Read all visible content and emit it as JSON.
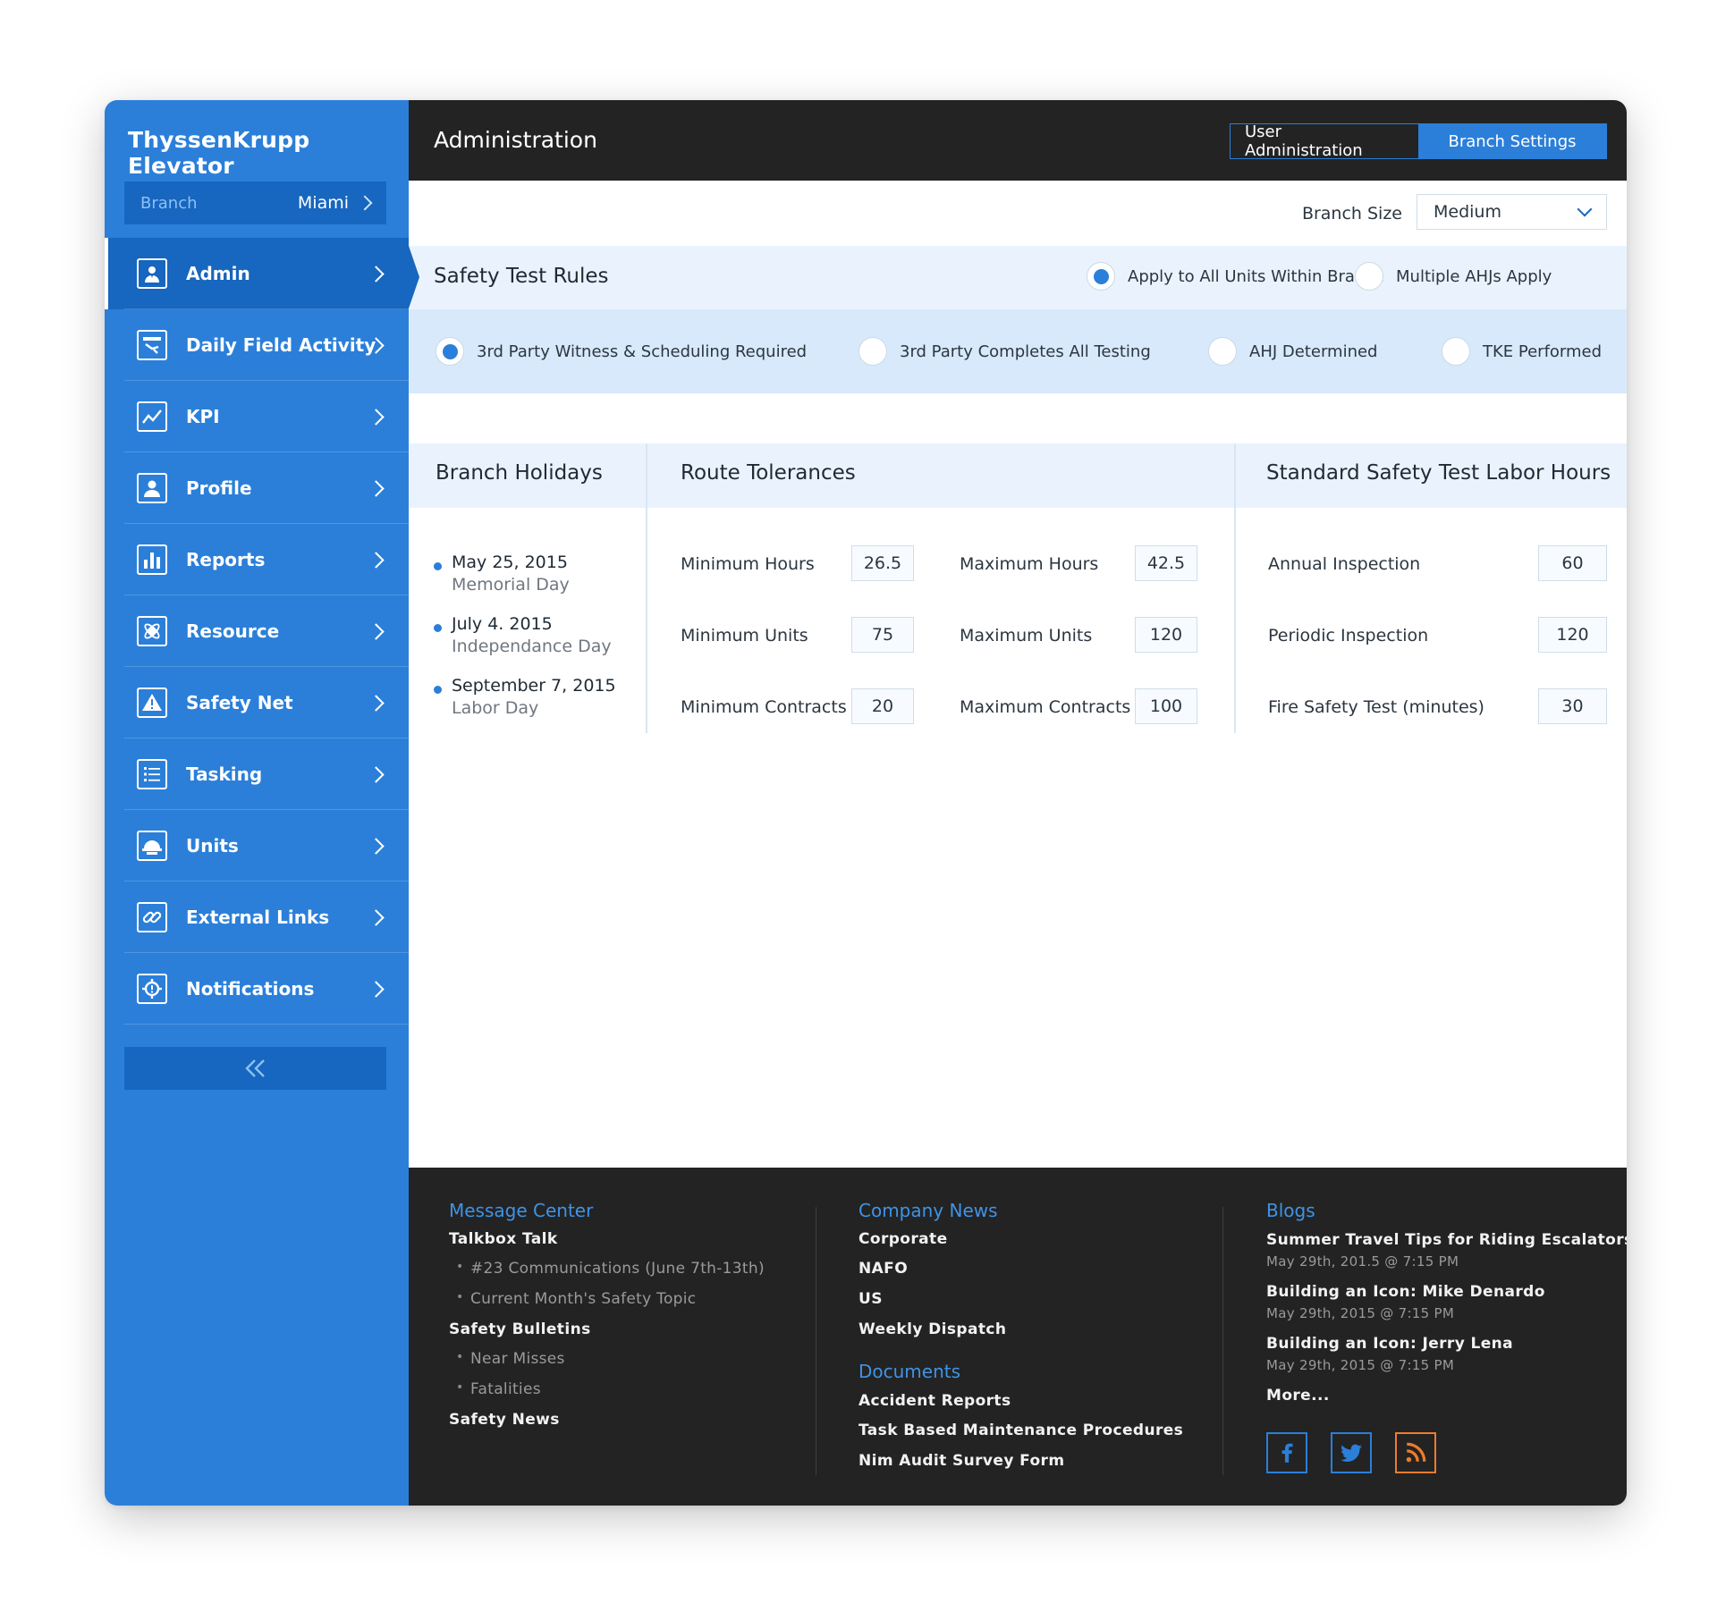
{
  "app": {
    "brand": "ThyssenKrupp Elevator",
    "branch_label": "Branch",
    "branch_value": "Miami"
  },
  "sidebar": {
    "items": [
      {
        "label": "Admin",
        "icon": "admin-icon",
        "active": true
      },
      {
        "label": "Daily Field Activity",
        "icon": "daily-field-activity-icon"
      },
      {
        "label": "KPI",
        "icon": "kpi-chart-icon"
      },
      {
        "label": "Profile",
        "icon": "profile-icon"
      },
      {
        "label": "Reports",
        "icon": "reports-bar-chart-icon"
      },
      {
        "label": "Resource",
        "icon": "resource-icon"
      },
      {
        "label": "Safety Net",
        "icon": "warning-icon"
      },
      {
        "label": "Tasking",
        "icon": "list-icon"
      },
      {
        "label": "Units",
        "icon": "hard-hat-icon"
      },
      {
        "label": "External Links",
        "icon": "link-icon"
      },
      {
        "label": "Notifications",
        "icon": "notification-gear-icon"
      }
    ],
    "collapse_icon": "double-chevron-left-icon"
  },
  "header": {
    "title": "Administration",
    "tabs": [
      "User Administration",
      "Branch Settings"
    ],
    "active_tab": "Branch Settings"
  },
  "branch_size": {
    "label": "Branch Size",
    "value": "Medium"
  },
  "safety_test_rules": {
    "title": "Safety Test Rules",
    "scope_options": [
      {
        "label": "Apply to All Units Within Branch",
        "selected": true
      },
      {
        "label": "Multiple AHJs Apply",
        "selected": false
      }
    ],
    "options": [
      {
        "label": "3rd Party Witness & Scheduling Required",
        "selected": true
      },
      {
        "label": "3rd Party Completes All Testing",
        "selected": false
      },
      {
        "label": "AHJ Determined",
        "selected": false
      },
      {
        "label": "TKE  Performed",
        "selected": false
      }
    ]
  },
  "branch_holidays": {
    "title": "Branch Holidays",
    "items": [
      {
        "date": "May 25, 2015",
        "name": "Memorial Day"
      },
      {
        "date": "July 4. 2015",
        "name": "Independance Day"
      },
      {
        "date": "September 7, 2015",
        "name": "Labor Day"
      }
    ]
  },
  "route_tolerances": {
    "title": "Route Tolerances",
    "fields": [
      {
        "label": "Minimum Hours",
        "value": "26.5"
      },
      {
        "label": "Maximum Hours",
        "value": "42.5"
      },
      {
        "label": "Minimum Units",
        "value": "75"
      },
      {
        "label": "Maximum Units",
        "value": "120"
      },
      {
        "label": "Minimum Contracts",
        "value": "20"
      },
      {
        "label": "Maximum Contracts",
        "value": "100"
      }
    ]
  },
  "labor_hours": {
    "title": "Standard Safety Test Labor Hours",
    "fields": [
      {
        "label": "Annual Inspection",
        "value": "60"
      },
      {
        "label": "Periodic Inspection",
        "value": "120"
      },
      {
        "label": "Fire Safety Test (minutes)",
        "value": "30"
      }
    ]
  },
  "footer": {
    "message_center": {
      "title": "Message Center",
      "talkbox": "Talkbox Talk",
      "talkbox_items": [
        "#23 Communications (June 7th-13th)",
        "Current Month's Safety Topic"
      ],
      "bulletins": "Safety Bulletins",
      "bulletin_items": [
        "Near Misses",
        "Fatalities"
      ],
      "news": "Safety News"
    },
    "company_news": {
      "title": "Company News",
      "items": [
        "Corporate",
        "NAFO",
        "US",
        "Weekly Dispatch"
      ]
    },
    "documents": {
      "title": "Documents",
      "items": [
        "Accident Reports",
        "Task Based Maintenance Procedures",
        "Nim Audit Survey Form"
      ]
    },
    "blogs": {
      "title": "Blogs",
      "items": [
        {
          "title": "Summer Travel Tips for Riding Escalators",
          "meta": "May 29th, 201.5 @ 7:15 PM"
        },
        {
          "title": "Building an Icon: Mike Denardo",
          "meta": "May 29th, 2015 @ 7:15 PM"
        },
        {
          "title": "Building an Icon: Jerry Lena",
          "meta": "May 29th, 2015 @ 7:15 PM"
        }
      ],
      "more": "More..."
    },
    "social": [
      "facebook-icon",
      "twitter-icon",
      "rss-icon"
    ]
  },
  "colors": {
    "sidebar": "#2b7fd9",
    "sidebar_dark": "#1766bf",
    "header": "#232323",
    "accent": "#2b7fd9",
    "rss": "#f07b2c"
  }
}
